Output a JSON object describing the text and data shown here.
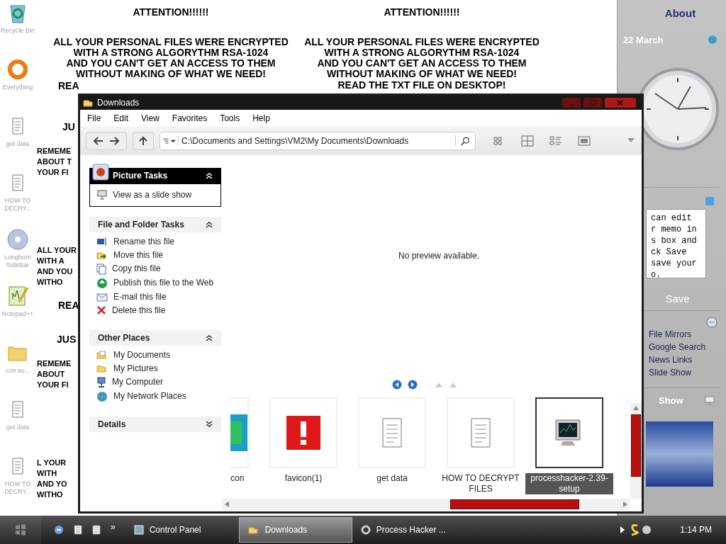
{
  "wallpaper": {
    "blocks": [
      {
        "heading": "ATTENTION!!!!!!",
        "lines": [
          "ALL YOUR PERSONAL FILES WERE ENCRYPTED",
          "WITH A STRONG ALGORYTHM RSA-1024",
          "AND YOU CAN'T GET AN ACCESS TO THEM",
          "WITHOUT MAKING OF WHAT WE NEED!"
        ]
      },
      {
        "lines": [
          "REA"
        ]
      },
      {
        "lines": [
          "JU"
        ]
      },
      {
        "lines": [
          "REMEME",
          "ABOUT T",
          "YOUR FI"
        ]
      },
      {
        "lines": [
          "ALL YOUR",
          "WITH A",
          "AND YOU",
          "WITHO"
        ]
      },
      {
        "lines": [
          "REA"
        ]
      },
      {
        "lines": [
          "JUS"
        ]
      },
      {
        "lines": [
          "REMEME",
          "ABOUT",
          "YOUR FI"
        ]
      },
      {
        "lines": [
          "L YOUR",
          "WITH",
          "AND YO",
          "WITHO"
        ]
      },
      {
        "heading": "ATTENTION!!!!!!",
        "lines": [
          "ALL YOUR PERSONAL FILES WERE ENCRYPTED",
          "WITH A STRONG ALGORYTHM RSA-1024",
          "AND YOU CAN'T GET AN ACCESS TO THEM",
          "WITHOUT MAKING OF WHAT WE NEED!"
        ],
        "footer": "READ THE TXT FILE ON DESKTOP!"
      }
    ]
  },
  "desktop_icons": [
    {
      "label": "Recycle Bin",
      "kind": "recycle"
    },
    {
      "label": "Everything",
      "kind": "ring"
    },
    {
      "label": "get data",
      "kind": "text"
    },
    {
      "label": "HOW TO DECRY...",
      "kind": "text"
    },
    {
      "label": "Longhorn SideBar",
      "kind": "disc"
    },
    {
      "label": "Notepad++",
      "kind": "notepad"
    },
    {
      "label": "con au...",
      "kind": "folder"
    },
    {
      "label": "get data",
      "kind": "text"
    },
    {
      "label": "HOW TO DECRY...",
      "kind": "text"
    }
  ],
  "explorer": {
    "title": "Downloads",
    "menu": [
      "File",
      "Edit",
      "View",
      "Favorites",
      "Tools",
      "Help"
    ],
    "address": "C:\\Documents and Settings\\VM2\\My Documents\\Downloads",
    "task_panes": [
      {
        "title": "Picture Tasks",
        "kind": "dark",
        "expanded": true,
        "items": [
          {
            "label": "View as a slide show",
            "kind": "slideshow"
          }
        ]
      },
      {
        "title": "File and Folder Tasks",
        "kind": "light",
        "expanded": true,
        "items": [
          {
            "label": "Rename this file",
            "kind": "rename"
          },
          {
            "label": "Move this file",
            "kind": "move"
          },
          {
            "label": "Copy this file",
            "kind": "copy"
          },
          {
            "label": "Publish this file to the Web",
            "kind": "globe"
          },
          {
            "label": "E-mail this file",
            "kind": "email"
          },
          {
            "label": "Delete this file",
            "kind": "delete"
          }
        ]
      },
      {
        "title": "Other Places",
        "kind": "light",
        "expanded": true,
        "items": [
          {
            "label": "My Documents",
            "kind": "documents"
          },
          {
            "label": "My Pictures",
            "kind": "folder"
          },
          {
            "label": "My Computer",
            "kind": "computer"
          },
          {
            "label": "My Network Places",
            "kind": "network"
          }
        ]
      },
      {
        "title": "Details",
        "kind": "light",
        "expanded": false
      }
    ],
    "preview_message": "No preview available.",
    "filmstrip": [
      {
        "label": "con",
        "kind": "image",
        "selected": false
      },
      {
        "label": "favicon(1)",
        "kind": "favicon",
        "selected": false
      },
      {
        "label": "get data",
        "kind": "text",
        "selected": false
      },
      {
        "label": "HOW TO DECRYPT FILES",
        "kind": "text",
        "selected": false
      },
      {
        "label": "processhacker-2.39-setup",
        "kind": "app",
        "selected": true
      }
    ]
  },
  "sidebar": {
    "about_title": "About",
    "date": "22 March",
    "memo_lines": [
      "can edit",
      "r memo in",
      "s box and",
      "ck Save",
      "save your",
      "o."
    ],
    "save_label": "Save",
    "links": [
      "File Mirrors",
      "Google Search",
      "News Links",
      "Slide Show"
    ],
    "show_title": "Show"
  },
  "taskbar": {
    "buttons": [
      {
        "label": "Control Panel",
        "kind": "control",
        "selected": false
      },
      {
        "label": "Downloads",
        "kind": "folder",
        "selected": true
      },
      {
        "label": "Process Hacker ...",
        "kind": "app",
        "selected": false
      }
    ],
    "more": "»",
    "clock": "1:14 PM"
  }
}
